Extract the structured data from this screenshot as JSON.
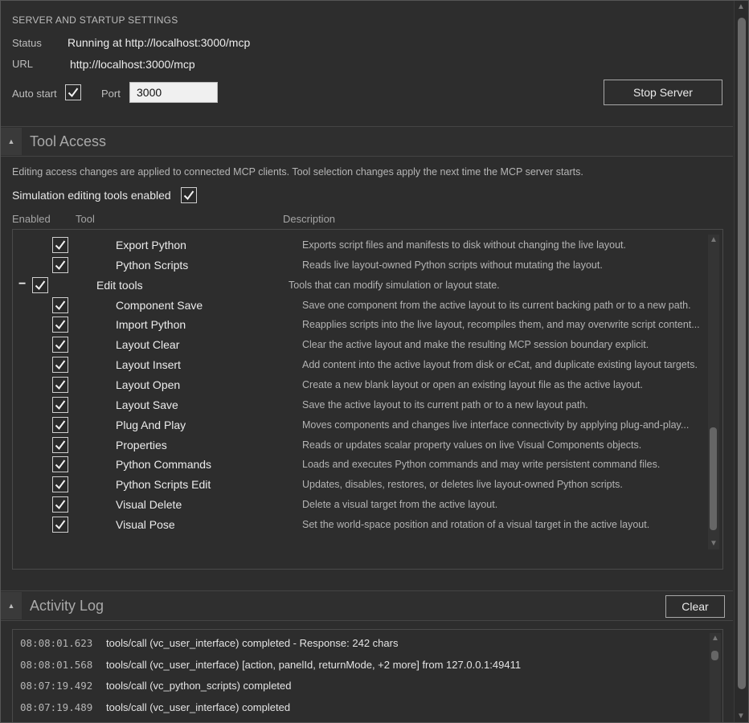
{
  "server": {
    "caption": "SERVER AND STARTUP SETTINGS",
    "status_label": "Status",
    "status_value": "Running at http://localhost:3000/mcp",
    "url_label": "URL",
    "url_value": "http://localhost:3000/mcp",
    "auto_start_label": "Auto start",
    "auto_start_checked": true,
    "port_label": "Port",
    "port_value": "3000",
    "stop_button": "Stop Server"
  },
  "tool_access": {
    "title": "Tool Access",
    "note": "Editing access changes are applied to connected MCP clients. Tool selection changes apply the next time the MCP server starts.",
    "sim_editing_label": "Simulation editing tools enabled",
    "sim_editing_checked": true,
    "columns": {
      "enabled": "Enabled",
      "tool": "Tool",
      "description": "Description"
    },
    "tools": [
      {
        "name": "Export Python",
        "description": "Exports script files and manifests to disk without changing the live layout.",
        "checked": true,
        "group": false
      },
      {
        "name": "Python Scripts",
        "description": "Reads live layout-owned Python scripts without mutating the layout.",
        "checked": true,
        "group": false
      },
      {
        "name": "Edit tools",
        "description": "Tools that can modify simulation or layout state.",
        "checked": true,
        "group": true,
        "expander": "−"
      },
      {
        "name": "Component Save",
        "description": "Save one component from the active layout to its current backing path or to a new path.",
        "checked": true,
        "group": false
      },
      {
        "name": "Import Python",
        "description": "Reapplies scripts into the live layout, recompiles them, and may overwrite script content...",
        "checked": true,
        "group": false
      },
      {
        "name": "Layout Clear",
        "description": "Clear the active layout and make the resulting MCP session boundary explicit.",
        "checked": true,
        "group": false
      },
      {
        "name": "Layout Insert",
        "description": "Add content into the active layout from disk or eCat, and duplicate existing layout targets.",
        "checked": true,
        "group": false
      },
      {
        "name": "Layout Open",
        "description": "Create a new blank layout or open an existing layout file as the active layout.",
        "checked": true,
        "group": false
      },
      {
        "name": "Layout Save",
        "description": "Save the active layout to its current path or to a new layout path.",
        "checked": true,
        "group": false
      },
      {
        "name": "Plug And Play",
        "description": "Moves components and changes live interface connectivity by applying plug-and-play...",
        "checked": true,
        "group": false
      },
      {
        "name": "Properties",
        "description": "Reads or updates scalar property values on live Visual Components objects.",
        "checked": true,
        "group": false
      },
      {
        "name": "Python Commands",
        "description": "Loads and executes Python commands and may write persistent command files.",
        "checked": true,
        "group": false
      },
      {
        "name": "Python Scripts Edit",
        "description": "Updates, disables, restores, or deletes live layout-owned Python scripts.",
        "checked": true,
        "group": false
      },
      {
        "name": "Visual Delete",
        "description": "Delete a visual target from the active layout.",
        "checked": true,
        "group": false
      },
      {
        "name": "Visual Pose",
        "description": "Set the world-space position and rotation of a visual target in the active layout.",
        "checked": true,
        "group": false
      }
    ]
  },
  "activity_log": {
    "title": "Activity Log",
    "clear_button": "Clear",
    "entries": [
      {
        "time": "08:08:01.623",
        "message": "tools/call (vc_user_interface) completed - Response: 242 chars"
      },
      {
        "time": "08:08:01.568",
        "message": "tools/call (vc_user_interface) [action, panelId, returnMode, +2 more] from 127.0.0.1:49411"
      },
      {
        "time": "08:07:19.492",
        "message": "tools/call (vc_python_scripts) completed"
      },
      {
        "time": "08:07:19.489",
        "message": "tools/call (vc_user_interface) completed"
      }
    ]
  },
  "icons": {
    "collapse": "collapse-up-icon",
    "check": "check-icon",
    "scroll_up": "scroll-up-arrow-icon",
    "scroll_down": "scroll-down-arrow-icon"
  }
}
